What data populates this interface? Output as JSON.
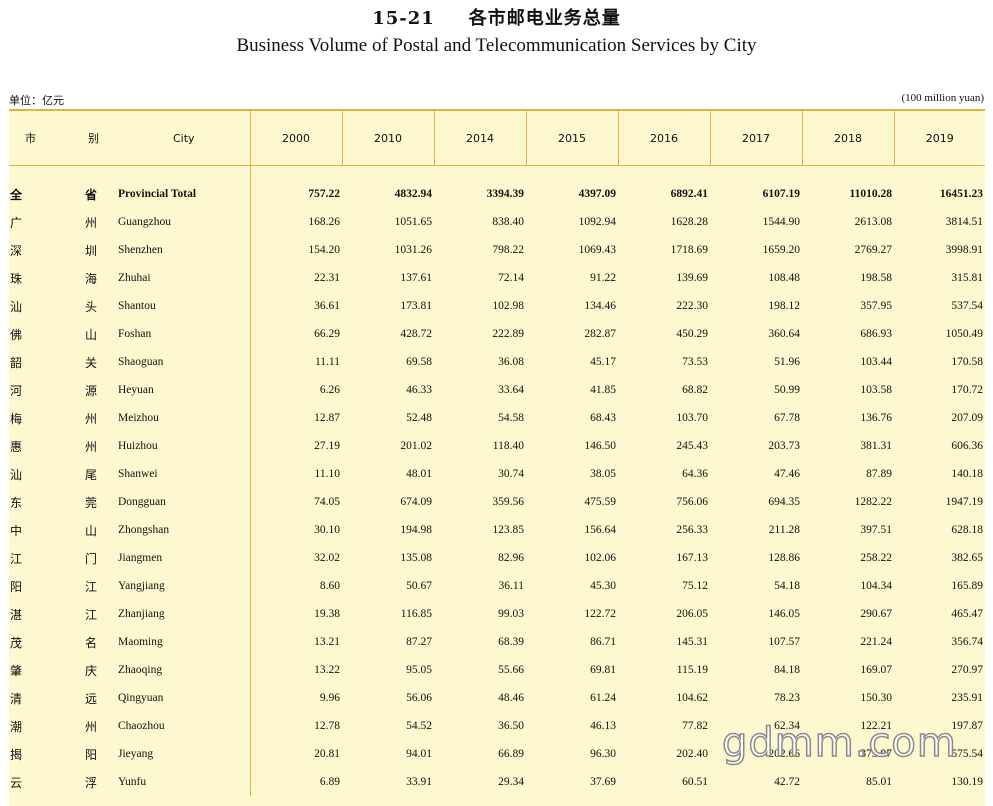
{
  "title": {
    "number": "15-21",
    "chinese": "各市邮电业务总量",
    "english": "Business Volume of Postal and Telecommunication Services by City"
  },
  "unit": {
    "chinese": "单位：亿元",
    "english": "(100 million yuan)"
  },
  "header": {
    "col1": "市",
    "col2": "别",
    "city": "City",
    "years": [
      "2000",
      "2010",
      "2014",
      "2015",
      "2016",
      "2017",
      "2018",
      "2019"
    ]
  },
  "rows": [
    {
      "cn1": "全",
      "cn2": "省",
      "en": "Provincial Total",
      "values": [
        "757.22",
        "4832.94",
        "3394.39",
        "4397.09",
        "6892.41",
        "6107.19",
        "11010.28",
        "16451.23"
      ]
    },
    {
      "cn1": "广",
      "cn2": "州",
      "en": "Guangzhou",
      "values": [
        "168.26",
        "1051.65",
        "838.40",
        "1092.94",
        "1628.28",
        "1544.90",
        "2613.08",
        "3814.51"
      ]
    },
    {
      "cn1": "深",
      "cn2": "圳",
      "en": "Shenzhen",
      "values": [
        "154.20",
        "1031.26",
        "798.22",
        "1069.43",
        "1718.69",
        "1659.20",
        "2769.27",
        "3998.91"
      ]
    },
    {
      "cn1": "珠",
      "cn2": "海",
      "en": "Zhuhai",
      "values": [
        "22.31",
        "137.61",
        "72.14",
        "91.22",
        "139.69",
        "108.48",
        "198.58",
        "315.81"
      ]
    },
    {
      "cn1": "汕",
      "cn2": "头",
      "en": "Shantou",
      "values": [
        "36.61",
        "173.81",
        "102.98",
        "134.46",
        "222.30",
        "198.12",
        "357.95",
        "537.54"
      ]
    },
    {
      "cn1": "佛",
      "cn2": "山",
      "en": "Foshan",
      "values": [
        "66.29",
        "428.72",
        "222.89",
        "282.87",
        "450.29",
        "360.64",
        "686.93",
        "1050.49"
      ]
    },
    {
      "cn1": "韶",
      "cn2": "关",
      "en": "Shaoguan",
      "values": [
        "11.11",
        "69.58",
        "36.08",
        "45.17",
        "73.53",
        "51.96",
        "103.44",
        "170.58"
      ]
    },
    {
      "cn1": "河",
      "cn2": "源",
      "en": "Heyuan",
      "values": [
        "6.26",
        "46.33",
        "33.64",
        "41.85",
        "68.82",
        "50.99",
        "103.58",
        "170.72"
      ]
    },
    {
      "cn1": "梅",
      "cn2": "州",
      "en": "Meizhou",
      "values": [
        "12.87",
        "52.48",
        "54.58",
        "68.43",
        "103.70",
        "67.78",
        "136.76",
        "207.09"
      ]
    },
    {
      "cn1": "惠",
      "cn2": "州",
      "en": "Huizhou",
      "values": [
        "27.19",
        "201.02",
        "118.40",
        "146.50",
        "245.43",
        "203.73",
        "381.31",
        "606.36"
      ]
    },
    {
      "cn1": "汕",
      "cn2": "尾",
      "en": "Shanwei",
      "values": [
        "11.10",
        "48.01",
        "30.74",
        "38.05",
        "64.36",
        "47.46",
        "87.89",
        "140.18"
      ]
    },
    {
      "cn1": "东",
      "cn2": "莞",
      "en": "Dongguan",
      "values": [
        "74.05",
        "674.09",
        "359.56",
        "475.59",
        "756.06",
        "694.35",
        "1282.22",
        "1947.19"
      ]
    },
    {
      "cn1": "中",
      "cn2": "山",
      "en": "Zhongshan",
      "values": [
        "30.10",
        "194.98",
        "123.85",
        "156.64",
        "256.33",
        "211.28",
        "397.51",
        "628.18"
      ]
    },
    {
      "cn1": "江",
      "cn2": "门",
      "en": "Jiangmen",
      "values": [
        "32.02",
        "135.08",
        "82.96",
        "102.06",
        "167.13",
        "128.86",
        "258.22",
        "382.65"
      ]
    },
    {
      "cn1": "阳",
      "cn2": "江",
      "en": "Yangjiang",
      "values": [
        "8.60",
        "50.67",
        "36.11",
        "45.30",
        "75.12",
        "54.18",
        "104.34",
        "165.89"
      ]
    },
    {
      "cn1": "湛",
      "cn2": "江",
      "en": "Zhanjiang",
      "values": [
        "19.38",
        "116.85",
        "99.03",
        "122.72",
        "206.05",
        "146.05",
        "290.67",
        "465.47"
      ]
    },
    {
      "cn1": "茂",
      "cn2": "名",
      "en": "Maoming",
      "values": [
        "13.21",
        "87.27",
        "68.39",
        "86.71",
        "145.31",
        "107.57",
        "221.24",
        "356.74"
      ]
    },
    {
      "cn1": "肇",
      "cn2": "庆",
      "en": "Zhaoqing",
      "values": [
        "13.22",
        "95.05",
        "55.66",
        "69.81",
        "115.19",
        "84.18",
        "169.07",
        "270.97"
      ]
    },
    {
      "cn1": "清",
      "cn2": "远",
      "en": "Qingyuan",
      "values": [
        "9.96",
        "56.06",
        "48.46",
        "61.24",
        "104.62",
        "78.23",
        "150.30",
        "235.91"
      ]
    },
    {
      "cn1": "潮",
      "cn2": "州",
      "en": "Chaozhou",
      "values": [
        "12.78",
        "54.52",
        "36.50",
        "46.13",
        "77.82",
        "62.34",
        "122.21",
        "197.87"
      ]
    },
    {
      "cn1": "揭",
      "cn2": "阳",
      "en": "Jieyang",
      "values": [
        "20.81",
        "94.01",
        "66.89",
        "96.30",
        "202.40",
        "202.66",
        "375.97",
        "575.54"
      ]
    },
    {
      "cn1": "云",
      "cn2": "浮",
      "en": "Yunfu",
      "values": [
        "6.89",
        "33.91",
        "29.34",
        "37.69",
        "60.51",
        "42.72",
        "85.01",
        "130.19"
      ]
    }
  ],
  "watermark": "gdmm.com",
  "colors": {
    "table_background": "#fdf8d0",
    "rule_line": "#e3b042"
  }
}
